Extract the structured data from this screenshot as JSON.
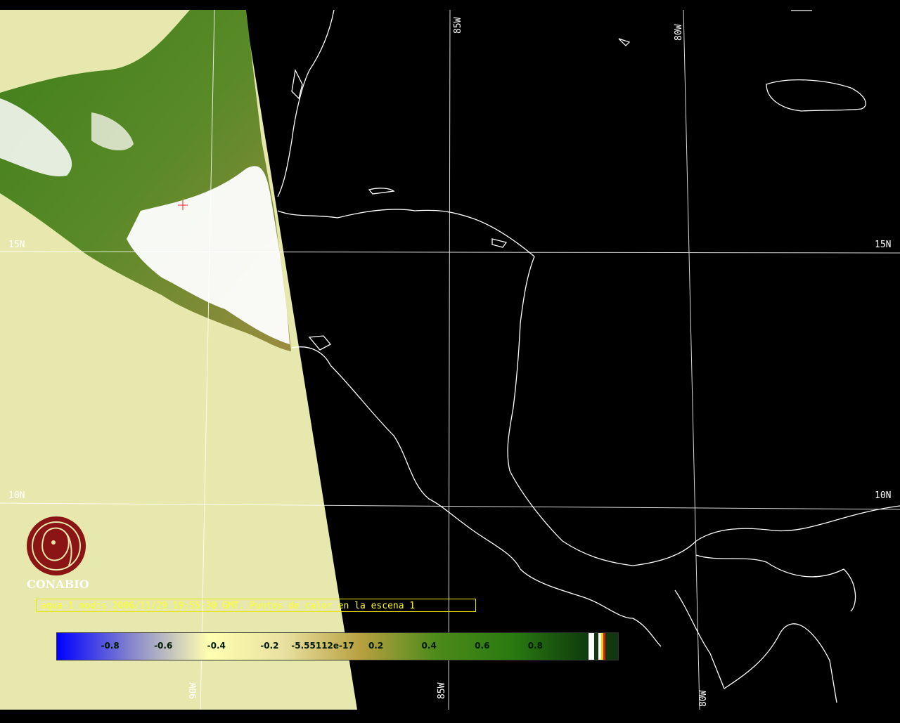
{
  "map": {
    "grid_labels": {
      "lon_top": [
        "85W",
        "80W"
      ],
      "lon_bottom": [
        "90W",
        "85W",
        "80W"
      ],
      "lat_left": [
        "15N",
        "10N"
      ],
      "lat_right": [
        "15N",
        "10N"
      ]
    },
    "colors": {
      "background": "#000000",
      "land_dry": "#e6e8ad",
      "vegetation": "#3f7f1a",
      "cloud": "#ffffff",
      "coastline": "#ffffff",
      "gridline": "#ffffff"
    }
  },
  "logo": {
    "name": "CONABIO",
    "icon": "conabio-logo-icon",
    "color": "#8b1414"
  },
  "caption": {
    "text": "aqua-1 modis 2006/11/29 19:55:30 GMT. Puntos de calor en la escena 1",
    "border_color": "#e8e800"
  },
  "legend": {
    "ticks": [
      "-0.8",
      "-0.6",
      "-0.4",
      "-0.2",
      "-5.55112e-17",
      "0.2",
      "0.4",
      "0.6",
      "0.8"
    ],
    "tick_values": [
      -0.8,
      -0.6,
      -0.4,
      -0.2,
      0.0,
      0.2,
      0.4,
      0.6,
      0.8
    ],
    "range": [
      -1,
      1
    ],
    "gradient_stops": [
      "#0000ff",
      "#8888cc",
      "#ffffb0",
      "#e8e0a0",
      "#b8a040",
      "#4d8a1a",
      "#2a7a10",
      "#0e3a0e"
    ]
  }
}
